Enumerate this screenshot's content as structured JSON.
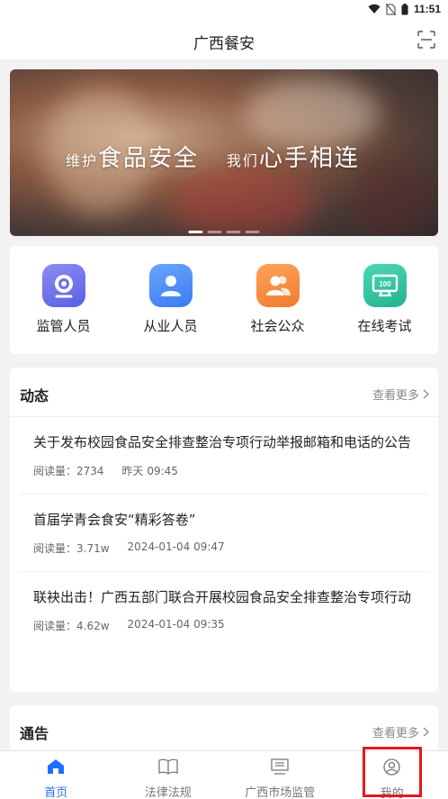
{
  "status_bar": {
    "time": "11:51"
  },
  "header": {
    "title": "广西餐安"
  },
  "banner": {
    "line1_small": "维护",
    "line1_big": "食品安全",
    "line2_small": "我们",
    "line2_big": "心手相连",
    "dot_count": 4,
    "active_dot": 1
  },
  "quick_entries": [
    {
      "label": "监管人员",
      "icon": "camera-icon",
      "color_from": "#8b8cf2",
      "color_to": "#5a5fe4"
    },
    {
      "label": "从业人员",
      "icon": "user-icon",
      "color_from": "#6aa5ff",
      "color_to": "#3a7bf0"
    },
    {
      "label": "社会公众",
      "icon": "people-icon",
      "color_from": "#ffa45c",
      "color_to": "#f07a2e"
    },
    {
      "label": "在线考试",
      "icon": "exam-icon",
      "color_from": "#4fd6b5",
      "color_to": "#22b391"
    }
  ],
  "news": {
    "section_title": "动态",
    "more_label": "查看更多",
    "items": [
      {
        "title": "关于发布校园食品安全排查整治专项行动举报邮箱和电话的公告",
        "reads": "阅读量：2734",
        "time": "昨天 09:45"
      },
      {
        "title": "首届学青会食安“精彩答卷”",
        "reads": "阅读量：3.71w",
        "time": "2024-01-04 09:47"
      },
      {
        "title": "联袂出击！广西五部门联合开展校园食品安全排查整治专项行动",
        "reads": "阅读量：4.62w",
        "time": "2024-01-04 09:35"
      }
    ]
  },
  "notice": {
    "section_title": "通告",
    "more_label": "查看更多"
  },
  "tabs": [
    {
      "label": "首页",
      "icon": "home-icon",
      "active": true
    },
    {
      "label": "法律法规",
      "icon": "book-icon",
      "active": false
    },
    {
      "label": "广西市场监管",
      "icon": "monitor-icon",
      "active": false
    },
    {
      "label": "我的",
      "icon": "profile-icon",
      "active": false
    }
  ],
  "colors": {
    "accent": "#1f6fff",
    "highlight": "#e81818"
  }
}
